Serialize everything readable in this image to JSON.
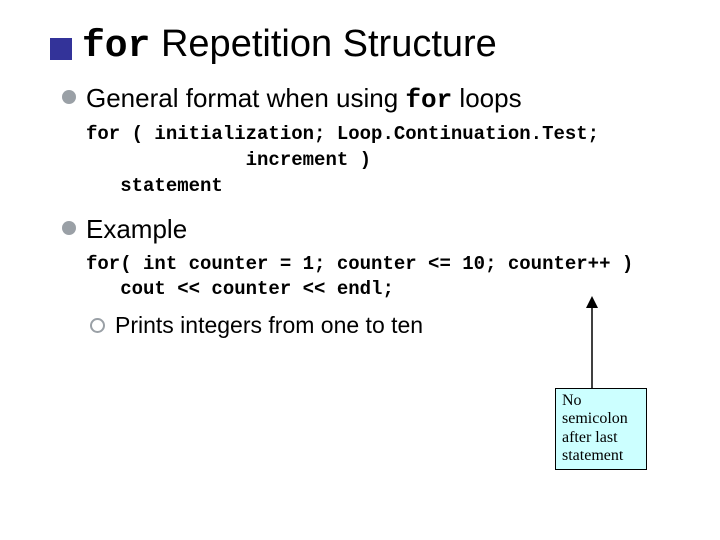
{
  "title": {
    "keyword": "for",
    "rest": " Repetition Structure"
  },
  "bullets": {
    "general": {
      "prefix": "General format when using ",
      "code_kw": "for",
      "suffix": " loops"
    },
    "example": "Example",
    "prints": "Prints integers from one to ten"
  },
  "code": {
    "general_format": "for ( initialization; Loop.Continuation.Test;\n              increment )\n   statement",
    "example_code": "for( int counter = 1; counter <= 10; counter++ )\n   cout << counter << endl;"
  },
  "callout": {
    "text": "No\nsemicolon\nafter last\nstatement"
  }
}
